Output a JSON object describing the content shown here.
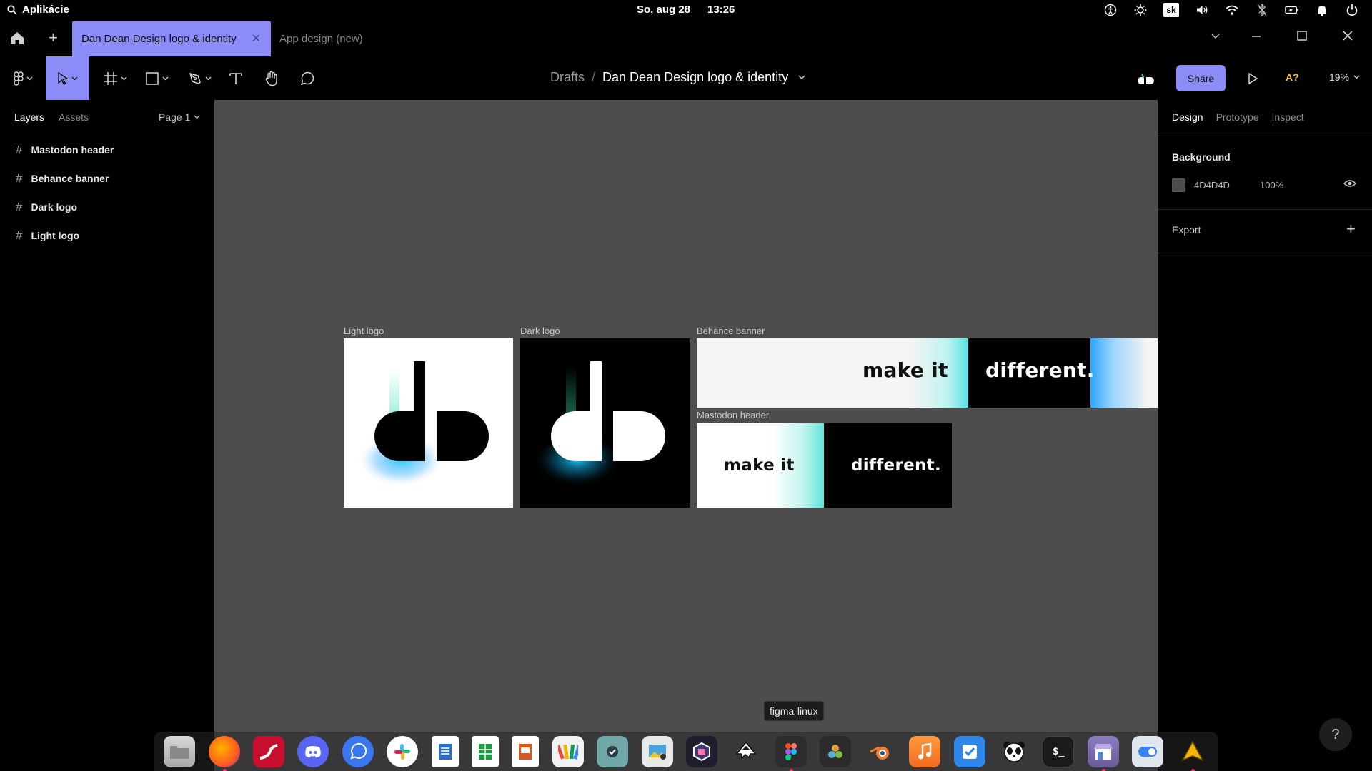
{
  "system_bar": {
    "apps_label": "Aplikácie",
    "date": "So, aug 28",
    "time": "13:26",
    "keyboard_layout": "sk"
  },
  "tabs": {
    "active_label": "Dan Dean Design logo & identity",
    "inactive_label": "App design (new)"
  },
  "toolbar": {
    "breadcrumb_root": "Drafts",
    "file_name": "Dan Dean Design logo & identity",
    "share_label": "Share",
    "accessibility_label": "A?",
    "zoom": "19%"
  },
  "left_panel": {
    "tab_layers": "Layers",
    "tab_assets": "Assets",
    "page": "Page 1",
    "layers": [
      {
        "name": "Mastodon header"
      },
      {
        "name": "Behance banner"
      },
      {
        "name": "Dark logo"
      },
      {
        "name": "Light logo"
      }
    ]
  },
  "canvas": {
    "background_color": "#4D4D4D",
    "frames": {
      "light_logo": "Light logo",
      "dark_logo": "Dark logo",
      "behance_banner": "Behance banner",
      "mastodon_header": "Mastodon header"
    },
    "banner_text_1": "make it",
    "banner_text_2": "different."
  },
  "right_panel": {
    "tab_design": "Design",
    "tab_prototype": "Prototype",
    "tab_inspect": "Inspect",
    "background_title": "Background",
    "background_hex": "4D4D4D",
    "background_opacity": "100%",
    "export_title": "Export"
  },
  "tooltip": "figma-linux",
  "help_label": "?",
  "colors": {
    "accent": "#8B8CF7",
    "canvas": "#4D4D4D",
    "panel": "#000000"
  }
}
